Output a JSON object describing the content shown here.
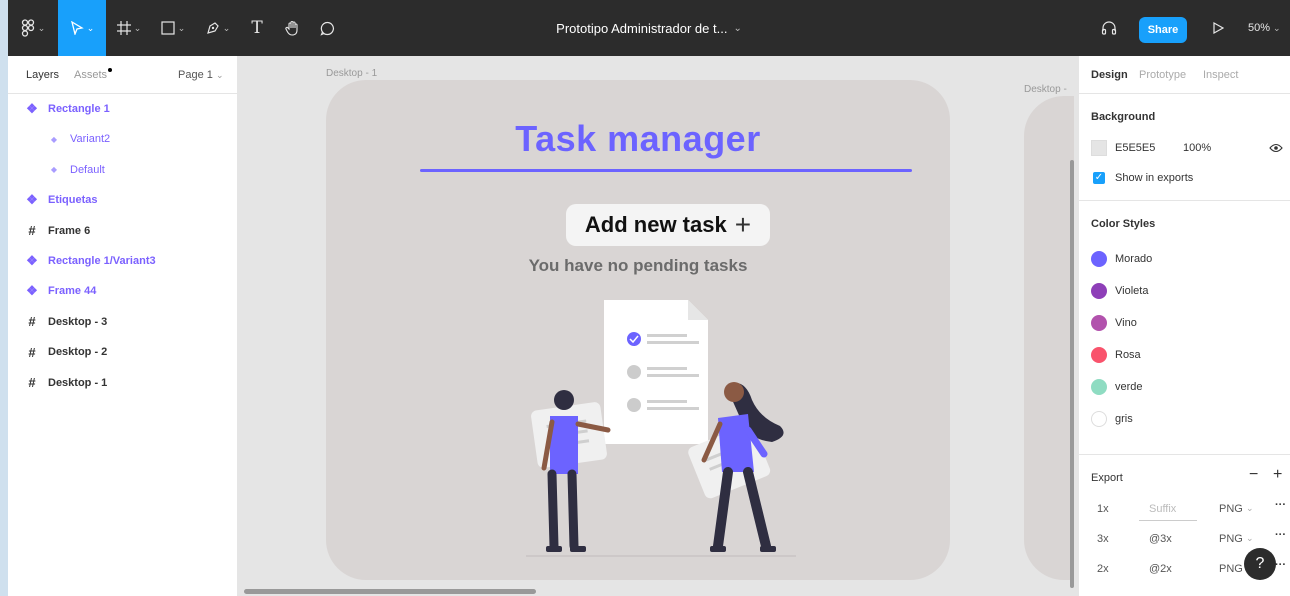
{
  "toolbar": {
    "figma_icon": "figma-menu-icon",
    "tools": [
      "move",
      "frame",
      "shape",
      "pen",
      "text",
      "hand",
      "comment"
    ],
    "text_tool": "T",
    "doc_title": "Prototipo Administrador de t...",
    "share_label": "Share",
    "zoom": "50%",
    "accent": "#18a0fb"
  },
  "left_panel": {
    "tab_layers": "Layers",
    "tab_assets": "Assets",
    "page": "Page 1",
    "layers": [
      {
        "label": "Rectangle 1",
        "kind": "component"
      },
      {
        "label": "Variant2",
        "kind": "instance"
      },
      {
        "label": "Default",
        "kind": "instance"
      },
      {
        "label": "Etiquetas",
        "kind": "component"
      },
      {
        "label": "Frame 6",
        "kind": "frame"
      },
      {
        "label": "Rectangle 1/Variant3",
        "kind": "component"
      },
      {
        "label": "Frame 44",
        "kind": "component"
      },
      {
        "label": "Desktop - 3",
        "kind": "frame"
      },
      {
        "label": "Desktop - 2",
        "kind": "frame"
      },
      {
        "label": "Desktop - 1",
        "kind": "frame"
      }
    ]
  },
  "canvas": {
    "frame1_label": "Desktop - 1",
    "frame2_label": "Desktop -",
    "title": "Task manager",
    "add_task": "Add new task",
    "empty_state": "You have no pending tasks",
    "accent": "#6c63ff"
  },
  "right_panel": {
    "tab_design": "Design",
    "tab_prototype": "Prototype",
    "tab_inspect": "Inspect",
    "background_title": "Background",
    "bg_hex": "E5E5E5",
    "bg_opacity": "100%",
    "show_in_exports": "Show in exports",
    "color_styles_title": "Color Styles",
    "color_styles": [
      {
        "name": "Morado",
        "color": "#6c63ff"
      },
      {
        "name": "Violeta",
        "color": "#8e3fb8"
      },
      {
        "name": "Vino",
        "color": "#b252ad"
      },
      {
        "name": "Rosa",
        "color": "#f9536c"
      },
      {
        "name": "verde",
        "color": "#8fdcc2"
      },
      {
        "name": "gris",
        "color": "#ffffff"
      }
    ],
    "export_title": "Export",
    "exports": [
      {
        "scale": "1x",
        "suffix": "Suffix",
        "format": "PNG"
      },
      {
        "scale": "3x",
        "suffix": "@3x",
        "format": "PNG"
      },
      {
        "scale": "2x",
        "suffix": "@2x",
        "format": "PNG"
      }
    ],
    "help": "?"
  }
}
